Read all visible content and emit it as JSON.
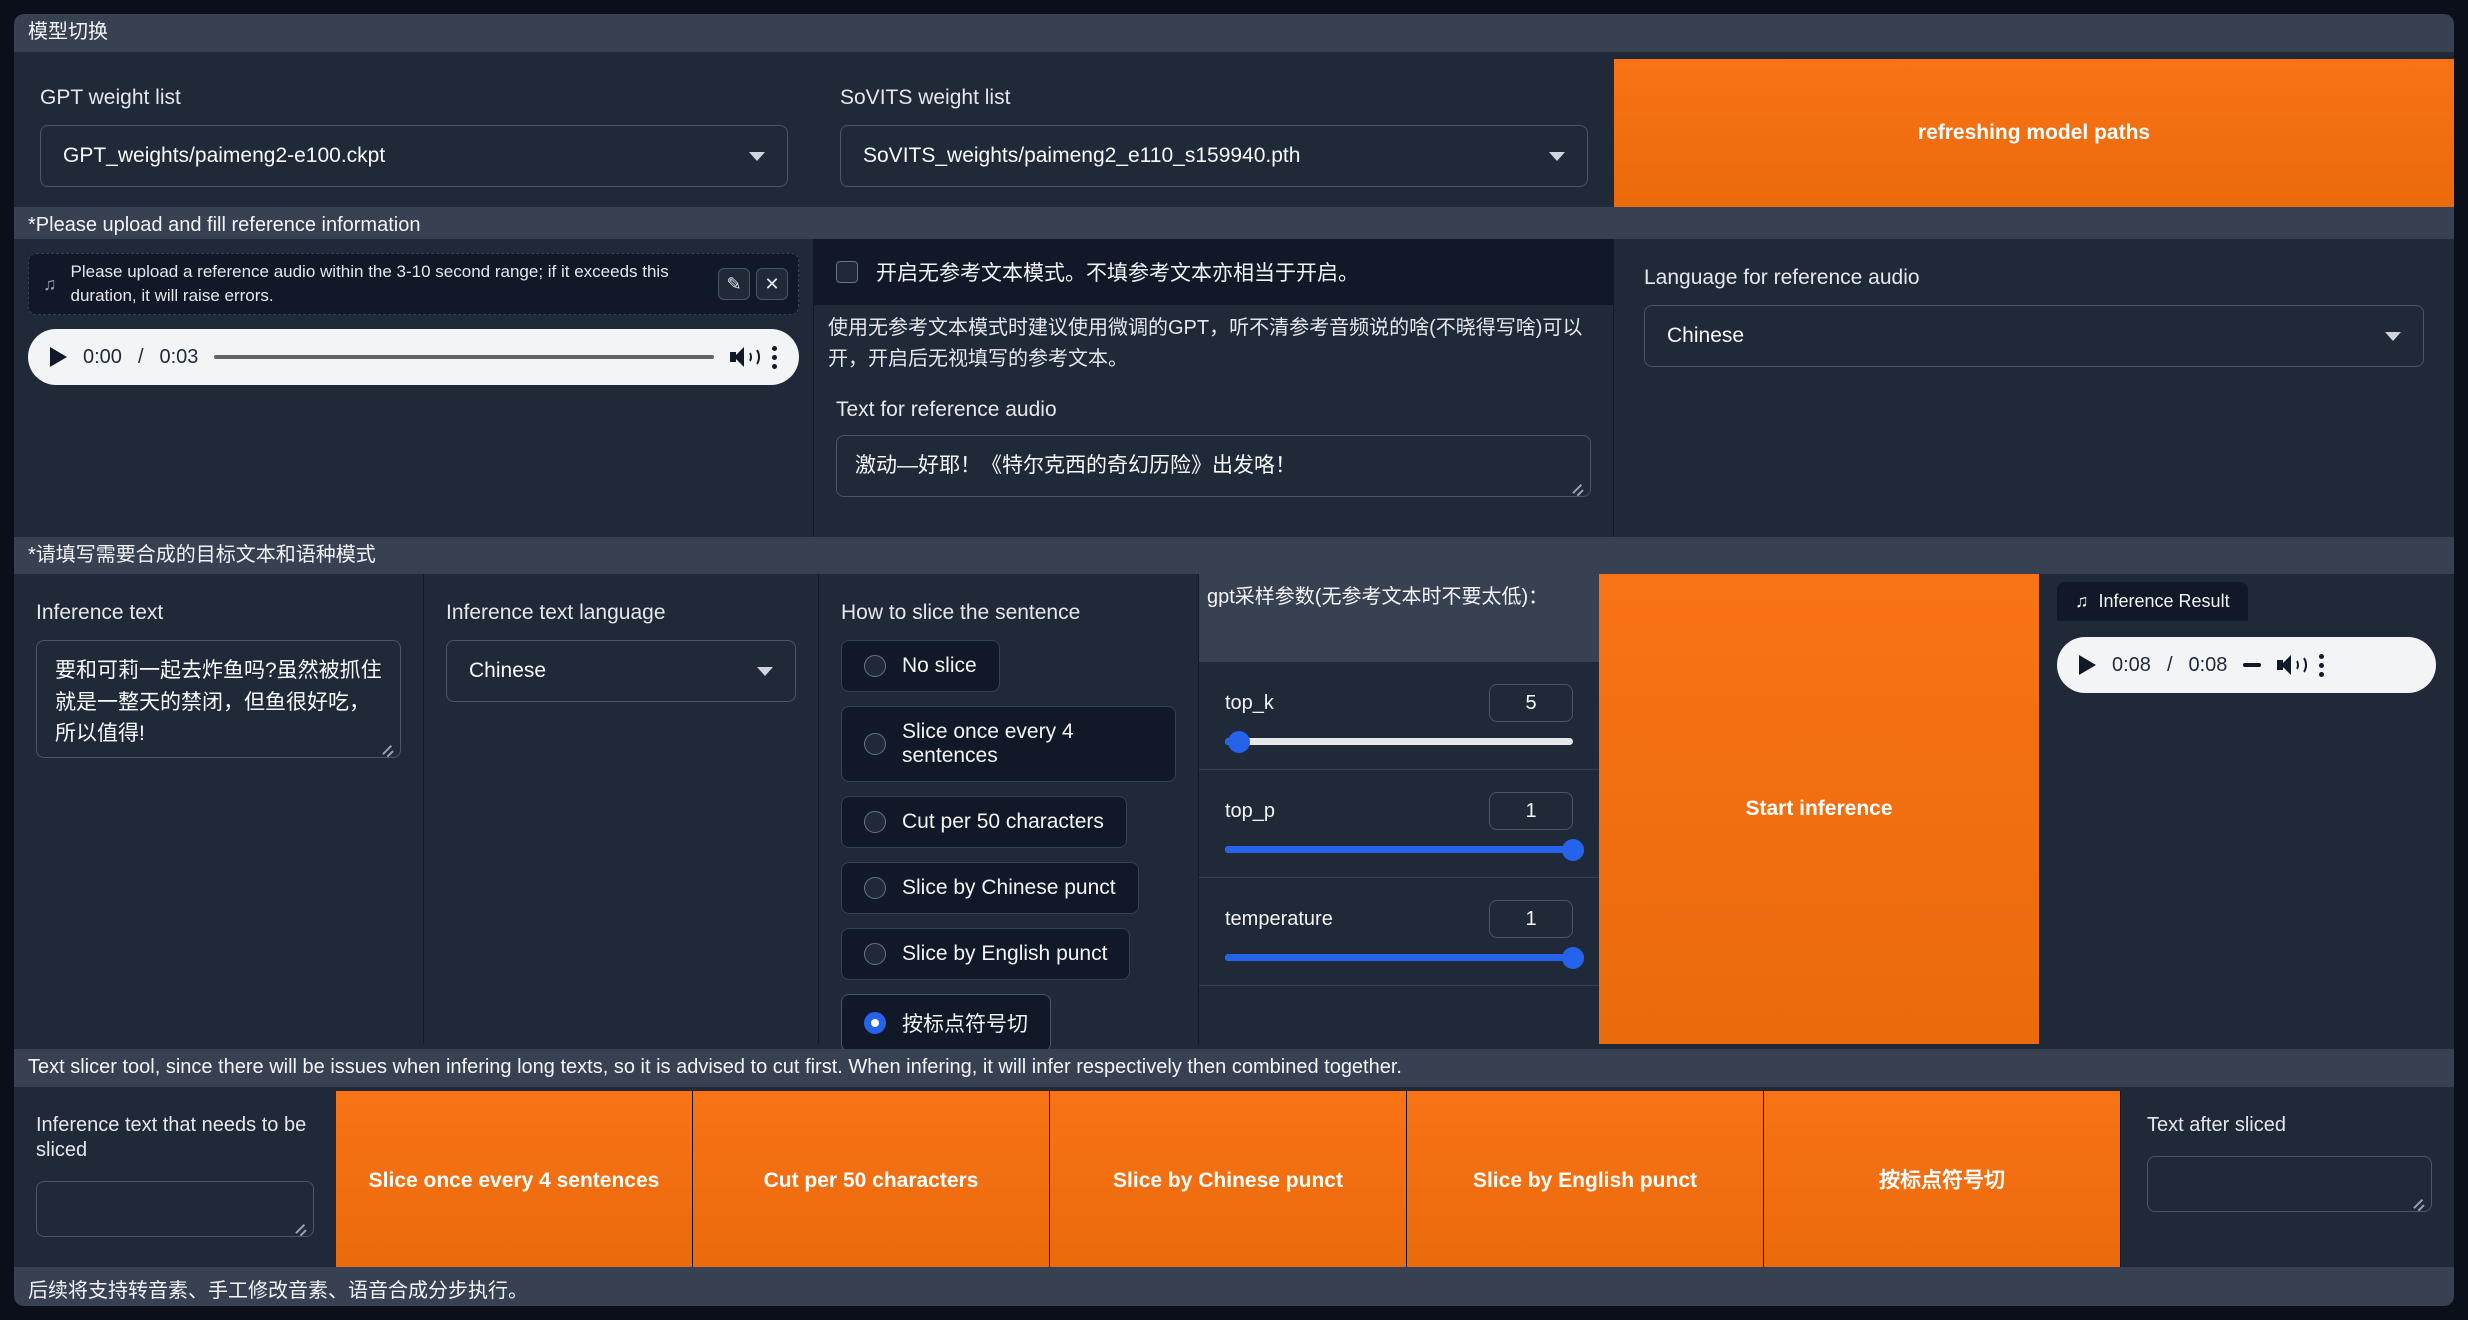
{
  "app": {
    "model_switch_label": "模型切换",
    "reference_section_label": "*Please upload and fill reference information",
    "target_section_label": "*请填写需要合成的目标文本和语种模式",
    "slicer_section_label": "Text slicer tool, since there will be issues when infering long texts, so it is advised to cut first. When infering, it will infer respectively then combined together.",
    "footer_note": "后续将支持转音素、手工修改音素、语音合成分步执行。"
  },
  "colors": {
    "accent_orange": "#f97316",
    "slider_blue": "#2563eb",
    "panel": "#1f2937",
    "panel_dark": "#111827",
    "header": "#374151"
  },
  "model_switch": {
    "gpt": {
      "label": "GPT weight list",
      "value": "GPT_weights/paimeng2-e100.ckpt"
    },
    "sovits": {
      "label": "SoVITS weight list",
      "value": "SoVITS_weights/paimeng2_e110_s159940.pth"
    },
    "refresh_button": "refreshing model paths"
  },
  "reference": {
    "upload_hint": "Please upload a reference audio within the 3-10 second range; if it exceeds this duration, it will raise errors.",
    "edit_icon": "✎",
    "clear_icon": "✕",
    "player": {
      "current_time": "0:00",
      "separator": "/",
      "duration": "0:03"
    },
    "no_ref_checkbox_label": "开启无参考文本模式。不填参考文本亦相当于开启。",
    "no_ref_checked": false,
    "note": "使用无参考文本模式时建议使用微调的GPT，听不清参考音频说的啥(不晓得写啥)可以开，开启后无视填写的参考文本。",
    "ref_text_label": "Text for reference audio",
    "ref_text_value": "激动—好耶！《特尔克西的奇幻历险》出发咯！",
    "language_label": "Language for reference audio",
    "language_value": "Chinese"
  },
  "inference": {
    "text_label": "Inference text",
    "text_value": "要和可莉一起去炸鱼吗?虽然被抓住就是一整天的禁闭，但鱼很好吃，所以值得!",
    "language_label": "Inference text language",
    "language_value": "Chinese",
    "slice_label": "How to slice the sentence",
    "slice_options": [
      {
        "label": "No slice",
        "selected": false
      },
      {
        "label": "Slice once every 4 sentences",
        "selected": false
      },
      {
        "label": "Cut per 50 characters",
        "selected": false
      },
      {
        "label": "Slice by Chinese punct",
        "selected": false
      },
      {
        "label": "Slice by English punct",
        "selected": false
      },
      {
        "label": "按标点符号切",
        "selected": true
      }
    ],
    "gpt_params_label": "gpt采样参数(无参考文本时不要太低)：",
    "sliders": [
      {
        "name": "top_k",
        "value": "5",
        "percent": 4
      },
      {
        "name": "top_p",
        "value": "1",
        "percent": 100
      },
      {
        "name": "temperature",
        "value": "1",
        "percent": 100
      }
    ],
    "start_button": "Start inference",
    "result_tab_label": "Inference Result",
    "result_player": {
      "current_time": "0:08",
      "separator": "/",
      "duration": "0:08"
    }
  },
  "slicer": {
    "input_label": "Inference text that needs to be sliced",
    "input_value": "",
    "buttons": [
      "Slice once every 4 sentences",
      "Cut per 50 characters",
      "Slice by Chinese punct",
      "Slice by English punct",
      "按标点符号切"
    ],
    "output_label": "Text after sliced",
    "output_value": ""
  }
}
